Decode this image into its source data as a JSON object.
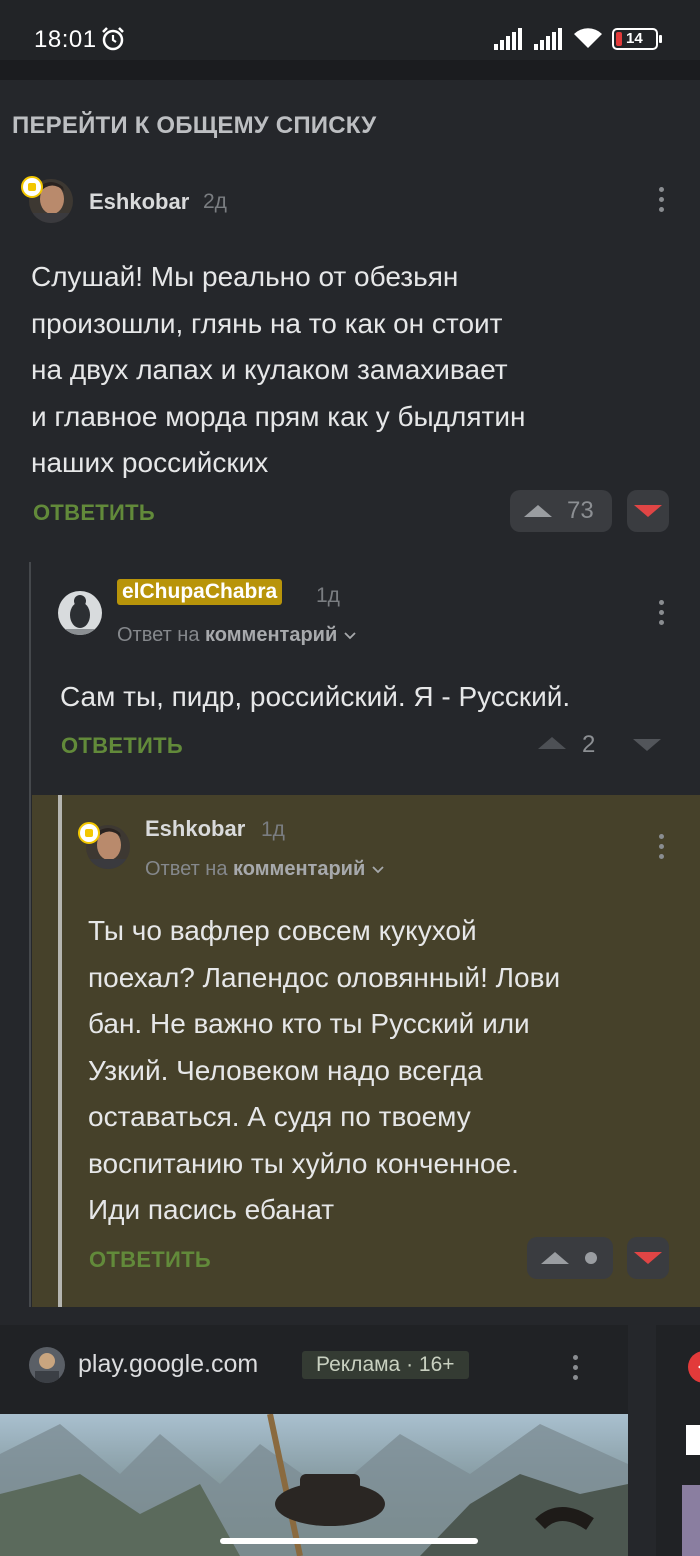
{
  "status_bar": {
    "time": "18:01",
    "battery": "14"
  },
  "header_link": "ПЕРЕЙТИ К ОБЩЕМУ СПИСКУ",
  "comments": [
    {
      "author": "Eshkobar",
      "age": "2д",
      "text_lines": [
        "Слушай! Мы реально от обезьян",
        "произошли, глянь на то как он стоит",
        "на двух лапах и кулаком замахивает",
        "и главное морда прям как у быдлятин",
        "наших российских"
      ],
      "reply_label": "ОТВЕТИТЬ",
      "score": "73"
    },
    {
      "author": "elChupaChabra",
      "age": "1д",
      "reply_to_prefix": "Ответ на",
      "reply_to_target": "комментарий",
      "text_lines": [
        "Сам ты, пидр, российский. Я - Русский."
      ],
      "reply_label": "ОТВЕТИТЬ",
      "score": "2"
    },
    {
      "author": "Eshkobar",
      "age": "1д",
      "reply_to_prefix": "Ответ на",
      "reply_to_target": "комментарий",
      "text_lines": [
        "Ты чо вафлер совсем кукухой",
        "поехал? Лапендос оловянный! Лови",
        "бан. Не важно кто ты Русский или",
        "Узкий. Человеком надо всегда",
        "оставаться. А судя по твоему",
        "воспитанию ты хуйло конченное.",
        "Иди пасись ебанат"
      ],
      "reply_label": "ОТВЕТИТЬ"
    }
  ],
  "ad": {
    "domain": "play.google.com",
    "label": "Реклама · 16+"
  },
  "colors": {
    "accent_green": "#628a3a",
    "downvote_red": "#e04545",
    "highlight_bg": "#46412a"
  }
}
